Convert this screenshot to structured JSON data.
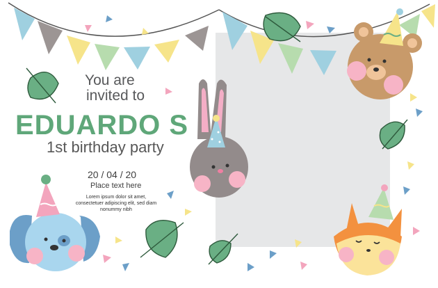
{
  "invitation": {
    "line1": "You are",
    "line2": "invited to",
    "name": "EDUARDO S",
    "event": "1st birthday party",
    "date": "20 / 04 / 20",
    "place": "Place text here",
    "lorem": "Lorem ipsum dolor sit amet, consectetuer adipiscing elit, sed diam nonummy nibh"
  },
  "colors": {
    "name_green": "#5fa779",
    "photo_placeholder": "#e6e7e8",
    "leaf_green": "#6aaf84",
    "bunting_blue": "#9fd0e0",
    "bunting_yellow": "#f6e48a",
    "bunting_green": "#b7dcae",
    "bunting_gray": "#9c9594"
  },
  "icons": [
    "bunting-flags",
    "leaf-icon",
    "confetti-triangle",
    "bunny-character",
    "bear-character",
    "fox-character",
    "puppy-character",
    "party-hat"
  ]
}
